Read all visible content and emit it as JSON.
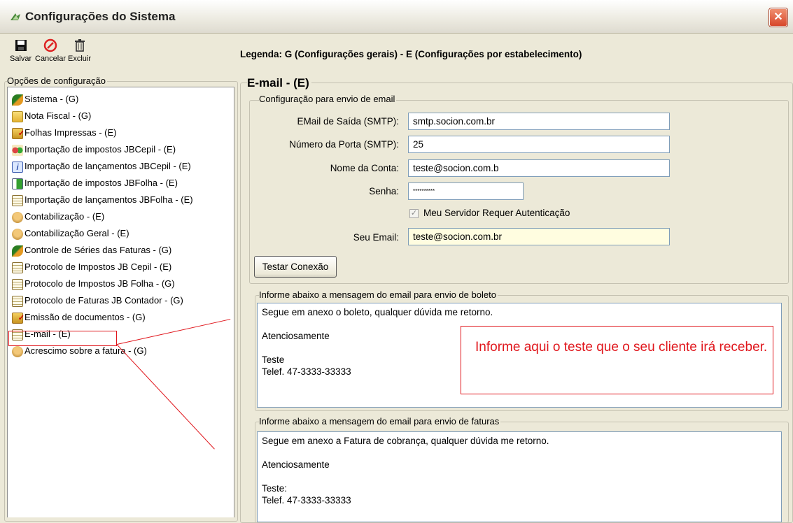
{
  "window": {
    "title": "Configurações do Sistema",
    "close": "✕"
  },
  "toolbar": {
    "save_label": "Salvar",
    "cancel_label": "Cancelar",
    "delete_label": "Excluir"
  },
  "legend": "Legenda: G (Configurações gerais) - E (Configurações por estabelecimento)",
  "sidebar": {
    "title": "Opções de configuração",
    "items": [
      {
        "label": "Sistema - (G)",
        "icon": "leaf-icon"
      },
      {
        "label": "Nota Fiscal - (G)",
        "icon": "folder-icon"
      },
      {
        "label": "Folhas Impressas - (E)",
        "icon": "checked-folder-icon"
      },
      {
        "label": "Importação de impostos JBCepil - (E)",
        "icon": "people-icon"
      },
      {
        "label": "Importação de lançamentos JBCepil - (E)",
        "icon": "info-icon"
      },
      {
        "label": "Importação de impostos JBFolha - (E)",
        "icon": "arrow-doc-icon"
      },
      {
        "label": "Importação de lançamentos JBFolha - (E)",
        "icon": "notepad-icon"
      },
      {
        "label": "Contabilização - (E)",
        "icon": "hand-icon"
      },
      {
        "label": "Contabilização Geral - (E)",
        "icon": "hand-icon"
      },
      {
        "label": "Controle de Séries das Faturas - (G)",
        "icon": "leaf-icon"
      },
      {
        "label": "Protocolo de Impostos JB Cepil - (E)",
        "icon": "notepad-icon"
      },
      {
        "label": "Protocolo de Impostos JB Folha - (G)",
        "icon": "notepad-icon"
      },
      {
        "label": "Protocolo de Faturas JB Contador - (G)",
        "icon": "notepad-icon"
      },
      {
        "label": "Emissão de documentos - (G)",
        "icon": "checked-folder-icon"
      },
      {
        "label": "E-mail - (E)",
        "icon": "notepad-icon",
        "selected": true
      },
      {
        "label": "Acrescimo sobre a fatura - (G)",
        "icon": "hand-icon"
      }
    ]
  },
  "main": {
    "section_title": "E-mail - (E)",
    "smtp_group": {
      "title": "Configuração para envio de email",
      "smtp_label": "EMail de Saída (SMTP):",
      "smtp_value": "smtp.socion.com.br",
      "port_label": "Número da Porta (SMTP):",
      "port_value": "25",
      "account_label": "Nome da Conta:",
      "account_value": "teste@socion.com.b",
      "password_label": "Senha:",
      "password_value": "**********",
      "auth_label": "Meu Servidor Requer Autenticação",
      "auth_checked": true,
      "your_email_label": "Seu Email:",
      "your_email_value": "teste@socion.com.br",
      "test_button": "Testar Conexão"
    },
    "boleto_group": {
      "title": "Informe abaixo a mensagem do email para envio de boleto",
      "message": "Segue em anexo o boleto, qualquer dúvida me retorno.\n\nAtenciosamente\n\nTeste\nTelef. 47-3333-33333"
    },
    "fatura_group": {
      "title": "Informe abaixo a mensagem do email para envio de faturas",
      "message": "Segue em anexo a Fatura de cobrança, qualquer dúvida me retorno.\n\nAtenciosamente\n\nTeste:\nTelef. 47-3333-33333"
    },
    "annotation": "Informe aqui o teste que o seu cliente irá receber."
  },
  "colors": {
    "annotation": "#e0161c",
    "window_bg": "#ece9d8"
  }
}
